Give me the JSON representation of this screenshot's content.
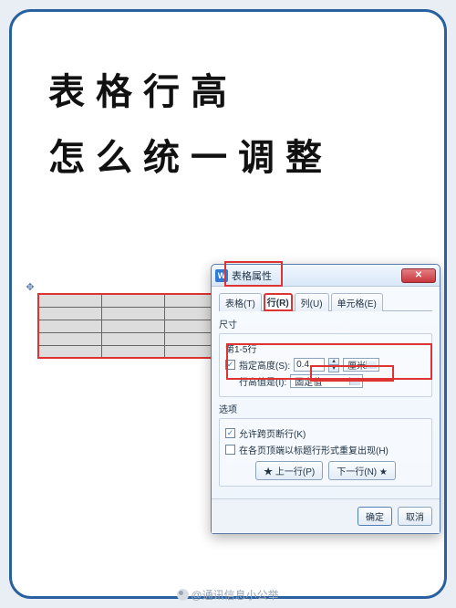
{
  "headline": {
    "line1": "表格行高",
    "line2": "怎么统一调整"
  },
  "dialog": {
    "title": "表格属性",
    "tabs": [
      "表格(T)",
      "行(R)",
      "列(U)",
      "单元格(E)"
    ],
    "active_tab": 1,
    "size_label": "尺寸",
    "rows_range": "第1-5行",
    "specify_height_label": "指定高度(S):",
    "specify_height_checked": true,
    "height_value": "0.4",
    "height_unit": "厘米",
    "row_height_is_label": "行高值是(I):",
    "row_height_mode": "固定值",
    "options_label": "选项",
    "allow_break_label": "允许跨页断行(K)",
    "allow_break_checked": true,
    "repeat_header_label": "在各页顶端以标题行形式重复出现(H)",
    "repeat_header_checked": false,
    "prev_row": "★ 上一行(P)",
    "next_row": "下一行(N) ★",
    "ok": "确定",
    "cancel": "取消"
  },
  "icons": {
    "app": "W",
    "close": "✕",
    "check": "✓",
    "up": "▲",
    "down": "▼"
  },
  "watermark": "@通讯信息小公举"
}
